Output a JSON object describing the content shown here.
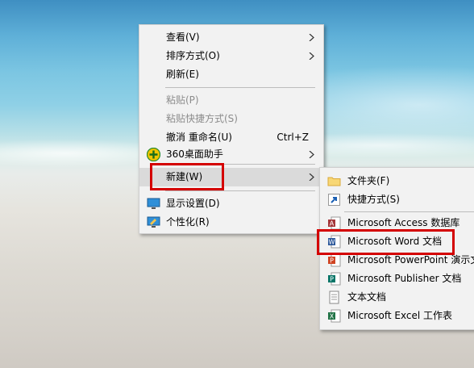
{
  "main_menu": {
    "items": [
      {
        "label": "查看(V)"
      },
      {
        "label": "排序方式(O)"
      },
      {
        "label": "刷新(E)"
      },
      {
        "label": "粘贴(P)"
      },
      {
        "label": "粘贴快捷方式(S)"
      },
      {
        "label": "撤消 重命名(U)",
        "shortcut": "Ctrl+Z"
      },
      {
        "label": "360桌面助手"
      },
      {
        "label": "新建(W)"
      },
      {
        "label": "显示设置(D)"
      },
      {
        "label": "个性化(R)"
      }
    ]
  },
  "sub_menu": {
    "items": [
      {
        "label": "文件夹(F)"
      },
      {
        "label": "快捷方式(S)"
      },
      {
        "label": "Microsoft Access 数据库"
      },
      {
        "label": "Microsoft Word 文档"
      },
      {
        "label": "Microsoft PowerPoint 演示文"
      },
      {
        "label": "Microsoft Publisher 文档"
      },
      {
        "label": "文本文档"
      },
      {
        "label": "Microsoft Excel 工作表"
      }
    ]
  },
  "colors": {
    "highlight_box": "#d40000",
    "menu_bg": "#f2f2f2",
    "disabled_text": "#8c8c8c"
  },
  "icons": {
    "shield": "360-shield-icon",
    "display": "display-settings-icon",
    "personalize": "personalize-icon",
    "folder": "folder-icon",
    "shortcut": "shortcut-icon",
    "access": "access-icon",
    "word": "word-icon",
    "powerpoint": "powerpoint-icon",
    "publisher": "publisher-icon",
    "text": "text-document-icon",
    "excel": "excel-icon"
  }
}
